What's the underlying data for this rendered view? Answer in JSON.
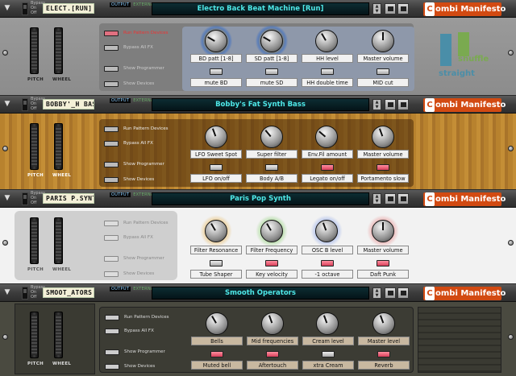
{
  "common": {
    "bypass_label": "Bypass\nOn\nOff",
    "output_label": "OUTPUT",
    "external_routing_label": "EXTERNAL ROUTING",
    "pitch_label": "PITCH",
    "wheel_label": "WHEEL",
    "logo_letter": "C",
    "logo_text": "ombi Manifesto",
    "panel_buttons": [
      "Run Pattern Devices",
      "Bypass All FX",
      "Show Programmer",
      "Show Devices"
    ]
  },
  "combinators": [
    {
      "tape": "ELECT.[RUN]",
      "patch_name": "Electro Back Beat Machine [Run]",
      "knobs": [
        "BD patt [1-8]",
        "SD patt [1-8]",
        "HH level",
        "Master volume"
      ],
      "buttons": [
        "mute BD",
        "mute SD",
        "HH double time",
        "MID cut"
      ],
      "active_panel_buttons": [
        true,
        false,
        false,
        false
      ],
      "button_states": [
        false,
        false,
        false,
        false
      ],
      "logo_shown": false,
      "side_art": {
        "top": "shuffle",
        "bottom": "straight"
      }
    },
    {
      "tape": "BOBBY'_H BASS",
      "patch_name": "Bobby's Fat Synth Bass",
      "knobs": [
        "LFO Sweet Spot",
        "Super filter",
        "Env.Fil amount",
        "Master volume"
      ],
      "buttons": [
        "LFO on/off",
        "Body A/B",
        "Legato on/off",
        "Portamento slow"
      ],
      "button_states": [
        false,
        false,
        true,
        true
      ],
      "logo_shown": true
    },
    {
      "tape": "PARIS P.SYNTH",
      "patch_name": "Paris Pop Synth",
      "knobs": [
        "Filter Resonance",
        "Filter Frequency",
        "OSC B level",
        "Master volume"
      ],
      "buttons": [
        "Tube Shaper",
        "Key velocity",
        "-1 octave",
        "Daft Punk"
      ],
      "button_states": [
        false,
        true,
        true,
        true
      ],
      "logo_shown": true
    },
    {
      "tape": "SMOOT_ATORS",
      "patch_name": "Smooth Operators",
      "knobs": [
        "Bells",
        "Mid frequencies",
        "Cream level",
        "Master level"
      ],
      "buttons": [
        "Muted bell",
        "Aftertouch",
        "xtra Cream",
        "Reverb"
      ],
      "button_states": [
        true,
        true,
        false,
        true
      ],
      "logo_shown": true
    }
  ],
  "colors": {
    "logo": "#d24a12",
    "patch_text": "#4ee8e8",
    "button_on": "#e05068"
  }
}
